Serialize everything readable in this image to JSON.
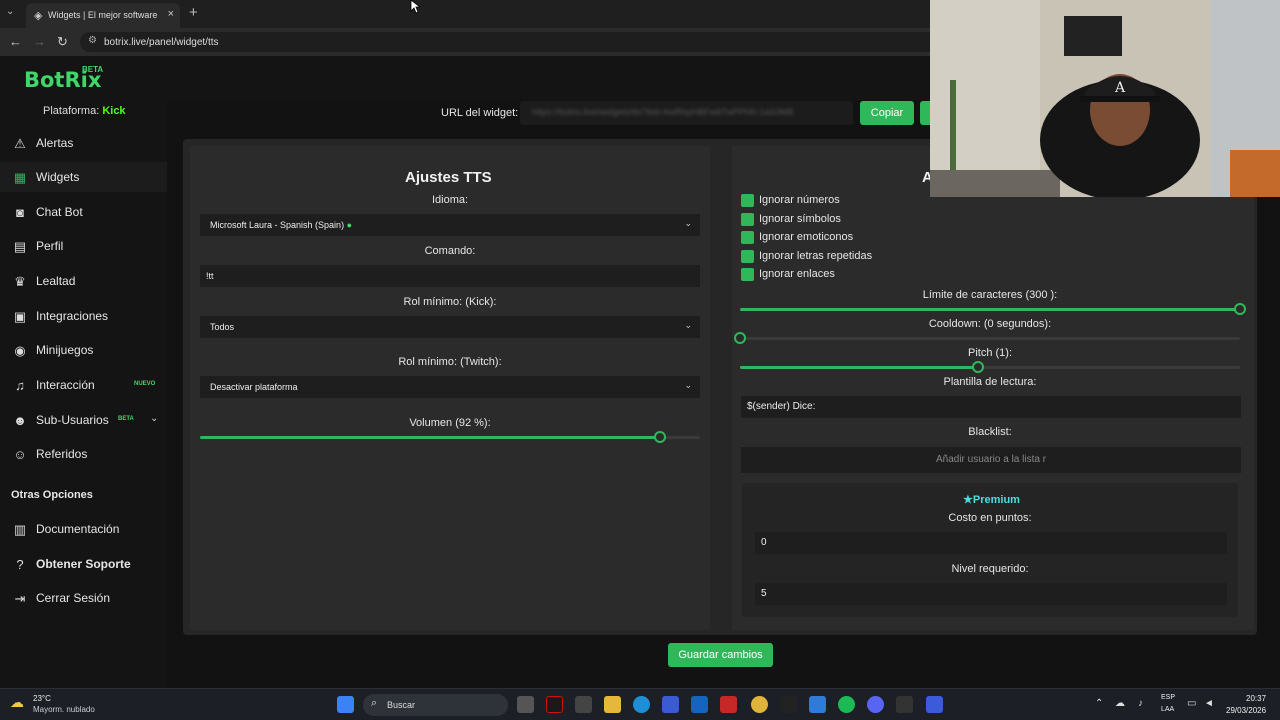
{
  "browser": {
    "tab_title": "Widgets | El mejor software para",
    "url": "botrix.live/panel/widget/tts"
  },
  "app": {
    "logo": "BotRix",
    "beta": "BETA"
  },
  "sidebar": {
    "platform_label": "Plataforma:",
    "platform_value": "Kick",
    "items": [
      {
        "label": "Alertas",
        "icon": "warning-icon"
      },
      {
        "label": "Widgets",
        "icon": "grid-icon"
      },
      {
        "label": "Chat Bot",
        "icon": "robot-icon"
      },
      {
        "label": "Perfil",
        "icon": "id-card-icon"
      },
      {
        "label": "Lealtad",
        "icon": "trophy-icon"
      },
      {
        "label": "Integraciones",
        "icon": "plug-icon"
      },
      {
        "label": "Minijuegos",
        "icon": "gamepad-icon"
      },
      {
        "label": "Interacción",
        "icon": "music-icon",
        "badge": "NUEVO"
      },
      {
        "label": "Sub-Usuarios",
        "icon": "users-icon",
        "badge": "BETA"
      },
      {
        "label": "Referidos",
        "icon": "user-group-icon"
      }
    ],
    "other_title": "Otras Opciones",
    "other_items": [
      {
        "label": "Documentación",
        "icon": "book-icon"
      },
      {
        "label": "Obtener Soporte",
        "icon": "help-icon"
      },
      {
        "label": "Cerrar Sesión",
        "icon": "logout-icon"
      }
    ]
  },
  "widget_url": {
    "label": "URL del widget:",
    "value": "https://botrix.live/widgets/tts?bid=kwRbpHBFw6TwPPHh-1a3JWB",
    "copy_label": "Copiar"
  },
  "left": {
    "title": "Ajustes TTS",
    "idioma_label": "Idioma:",
    "idioma_value": "Microsoft Laura - Spanish (Spain)",
    "comando_label": "Comando:",
    "comando_value": "!tt",
    "rol_kick_label": "Rol mínimo: (Kick):",
    "rol_kick_value": "Todos",
    "rol_twitch_label": "Rol mínimo: (Twitch):",
    "rol_twitch_value": "Desactivar plataforma",
    "volumen_label": "Volumen (92 %):",
    "volumen_fraction": 0.92
  },
  "right": {
    "title_partial": "A",
    "checks": [
      "Ignorar números",
      "Ignorar símbolos",
      "Ignorar emoticonos",
      "Ignorar letras repetidas",
      "Ignorar enlaces"
    ],
    "limite_label": "Límite de caracteres (300 ):",
    "limite_fraction": 1.0,
    "cooldown_label": "Cooldown: (0 segundos):",
    "cooldown_fraction": 0.0,
    "pitch_label": "Pitch (1):",
    "pitch_fraction": 0.475,
    "plantilla_label": "Plantilla de lectura:",
    "plantilla_value": "$(sender) Dice:",
    "blacklist_label": "Blacklist:",
    "blacklist_placeholder": "Añadir usuario a la lista r",
    "premium_label": "Premium",
    "costo_label": "Costo en puntos:",
    "costo_value": "0",
    "nivel_label": "Nivel requerido:",
    "nivel_value": "5"
  },
  "save_label": "Guardar cambios",
  "taskbar": {
    "temp": "23°C",
    "weather": "Mayorm. nublado",
    "search": "Buscar",
    "lang1": "ESP",
    "lang2": "LAA",
    "time": "20:37",
    "date": "29/03/2026"
  },
  "colors": {
    "accent": "#2fb85a",
    "kick": "#53fc18",
    "premium": "#46e0e0"
  }
}
